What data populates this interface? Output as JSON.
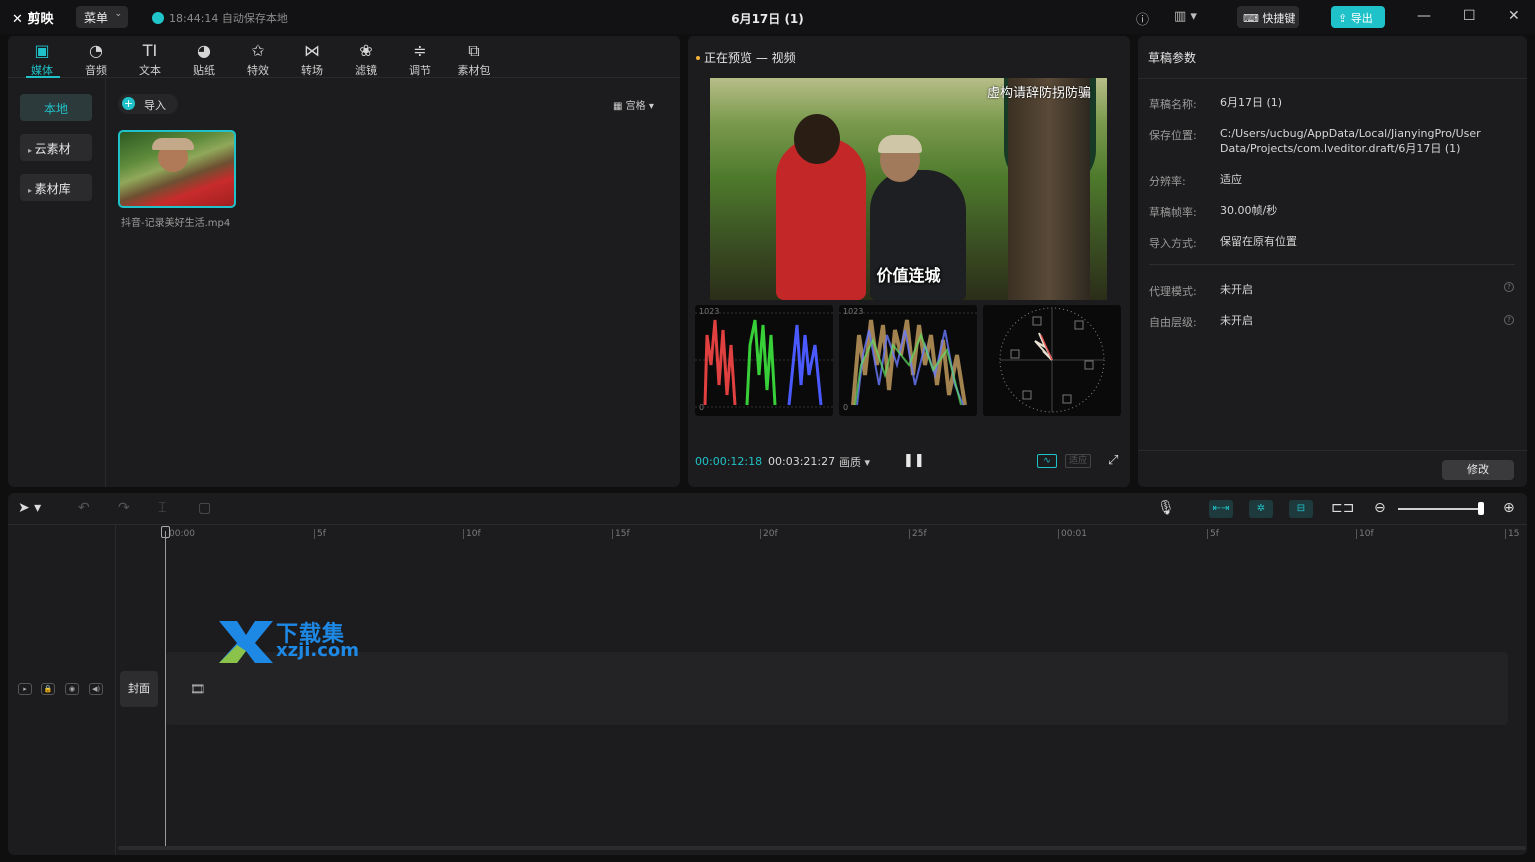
{
  "app": {
    "logo": "剪映",
    "menu_label": "菜单",
    "autosave": "18:44:14 自动保存本地",
    "doc_title": "6月17日 (1)",
    "shortcut_label": "快捷键",
    "export_label": "导出"
  },
  "media": {
    "tabs": [
      {
        "label": "媒体",
        "icon": "media-icon",
        "glyph": "▣"
      },
      {
        "label": "音频",
        "icon": "audio-icon",
        "glyph": "◔"
      },
      {
        "label": "文本",
        "icon": "text-icon",
        "glyph": "TI"
      },
      {
        "label": "贴纸",
        "icon": "sticker-icon",
        "glyph": "◕"
      },
      {
        "label": "特效",
        "icon": "effects-icon",
        "glyph": "✩"
      },
      {
        "label": "转场",
        "icon": "transition-icon",
        "glyph": "⋈"
      },
      {
        "label": "滤镜",
        "icon": "filter-icon",
        "glyph": "❀"
      },
      {
        "label": "调节",
        "icon": "adjust-icon",
        "glyph": "≑"
      },
      {
        "label": "素材包",
        "icon": "pack-icon",
        "glyph": "⧉"
      }
    ],
    "side": [
      "本地",
      "云素材",
      "素材库"
    ],
    "import_label": "导入",
    "view_label": "宫格",
    "clip_name": "抖音-记录美好生活.mp4"
  },
  "preview": {
    "title": "正在预览 — 视频",
    "watermark": "虚构请辞防拐防骗",
    "subtitle": "价值连城",
    "scope_max": "1023",
    "scope_min": "0",
    "timecode": "00:00:12:18",
    "duration": "00:03:21:27",
    "quality_label": "画质",
    "fit_label": "适应"
  },
  "props": {
    "title": "草稿参数",
    "items": [
      {
        "label": "草稿名称:",
        "value": "6月17日 (1)"
      },
      {
        "label": "保存位置:",
        "value": "C:/Users/ucbug/AppData/Local/JianyingPro/User Data/Projects/com.lveditor.draft/6月17日 (1)"
      },
      {
        "label": "分辨率:",
        "value": "适应"
      },
      {
        "label": "草稿帧率:",
        "value": "30.00帧/秒"
      },
      {
        "label": "导入方式:",
        "value": "保留在原有位置"
      },
      {
        "label": "代理模式:",
        "value": "未开启"
      },
      {
        "label": "自由层级:",
        "value": "未开启"
      }
    ],
    "modify_label": "修改"
  },
  "timeline": {
    "ticks": [
      "00:00",
      "5f",
      "10f",
      "15f",
      "20f",
      "25f",
      "00:01",
      "5f",
      "10f",
      "15"
    ],
    "cover_label": "封面"
  },
  "watermark": {
    "cn": "下载集",
    "url": "xzji.com"
  },
  "colors": {
    "accent": "#1fc2c8",
    "panel": "#1c1c1e",
    "background": "#0f0f10"
  }
}
